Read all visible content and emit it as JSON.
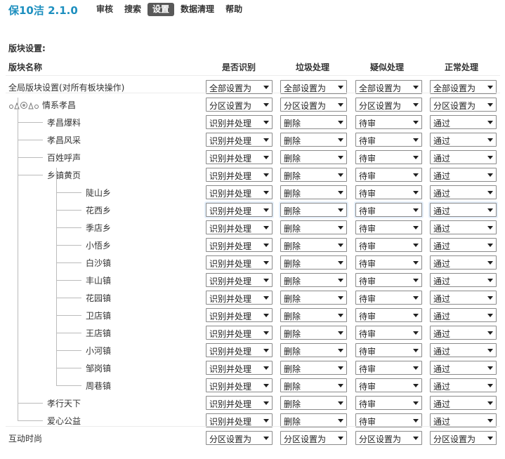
{
  "header": {
    "brand": "保10洁  2.1.0",
    "nav": [
      {
        "label": "审核",
        "active": false
      },
      {
        "label": "搜索",
        "active": false
      },
      {
        "label": "设置",
        "active": true
      },
      {
        "label": "数据清理",
        "active": false
      },
      {
        "label": "帮助",
        "active": false
      }
    ]
  },
  "section_title": "版块设置:",
  "columns": {
    "name": "版块名称",
    "recognize": "是否识别",
    "spam": "垃圾处理",
    "suspect": "疑似处理",
    "normal": "正常处理"
  },
  "forum_icon": "forum-group-icon",
  "rows": [
    {
      "name": "全局版块设置(对所有板块操作)",
      "level": 0,
      "values": [
        "全部设置为",
        "全部设置为",
        "全部设置为",
        "全部设置为"
      ]
    },
    {
      "name": "情系孝昌",
      "level": 0,
      "icon": true,
      "values": [
        "分区设置为",
        "分区设置为",
        "分区设置为",
        "分区设置为"
      ]
    },
    {
      "name": "孝昌爆料",
      "level": 1,
      "values": [
        "识别并处理",
        "删除",
        "待审",
        "通过"
      ]
    },
    {
      "name": "孝昌风采",
      "level": 1,
      "values": [
        "识别并处理",
        "删除",
        "待审",
        "通过"
      ]
    },
    {
      "name": "百姓呼声",
      "level": 1,
      "values": [
        "识别并处理",
        "删除",
        "待审",
        "通过"
      ]
    },
    {
      "name": "乡镇黄页",
      "level": 1,
      "values": [
        "识别并处理",
        "删除",
        "待审",
        "通过"
      ]
    },
    {
      "name": "陡山乡",
      "level": 2,
      "values": [
        "识别并处理",
        "删除",
        "待审",
        "通过"
      ]
    },
    {
      "name": "花西乡",
      "level": 2,
      "highlight": true,
      "values": [
        "识别并处理",
        "删除",
        "待审",
        "通过"
      ]
    },
    {
      "name": "季店乡",
      "level": 2,
      "values": [
        "识别并处理",
        "删除",
        "待审",
        "通过"
      ]
    },
    {
      "name": "小悟乡",
      "level": 2,
      "values": [
        "识别并处理",
        "删除",
        "待审",
        "通过"
      ]
    },
    {
      "name": "白沙镇",
      "level": 2,
      "values": [
        "识别并处理",
        "删除",
        "待审",
        "通过"
      ]
    },
    {
      "name": "丰山镇",
      "level": 2,
      "values": [
        "识别并处理",
        "删除",
        "待审",
        "通过"
      ]
    },
    {
      "name": "花园镇",
      "level": 2,
      "values": [
        "识别并处理",
        "删除",
        "待审",
        "通过"
      ]
    },
    {
      "name": "卫店镇",
      "level": 2,
      "values": [
        "识别并处理",
        "删除",
        "待审",
        "通过"
      ]
    },
    {
      "name": "王店镇",
      "level": 2,
      "values": [
        "识别并处理",
        "删除",
        "待审",
        "通过"
      ]
    },
    {
      "name": "小河镇",
      "level": 2,
      "values": [
        "识别并处理",
        "删除",
        "待审",
        "通过"
      ]
    },
    {
      "name": "邹岗镇",
      "level": 2,
      "values": [
        "识别并处理",
        "删除",
        "待审",
        "通过"
      ]
    },
    {
      "name": "周巷镇",
      "level": 2,
      "values": [
        "识别并处理",
        "删除",
        "待审",
        "通过"
      ]
    },
    {
      "name": "孝行天下",
      "level": 1,
      "values": [
        "识别并处理",
        "删除",
        "待审",
        "通过"
      ]
    },
    {
      "name": "爱心公益",
      "level": 1,
      "values": [
        "识别并处理",
        "删除",
        "待审",
        "通过"
      ]
    },
    {
      "name": "互动时尚",
      "level": 0,
      "values": [
        "分区设置为",
        "分区设置为",
        "分区设置为",
        "分区设置为"
      ]
    }
  ]
}
